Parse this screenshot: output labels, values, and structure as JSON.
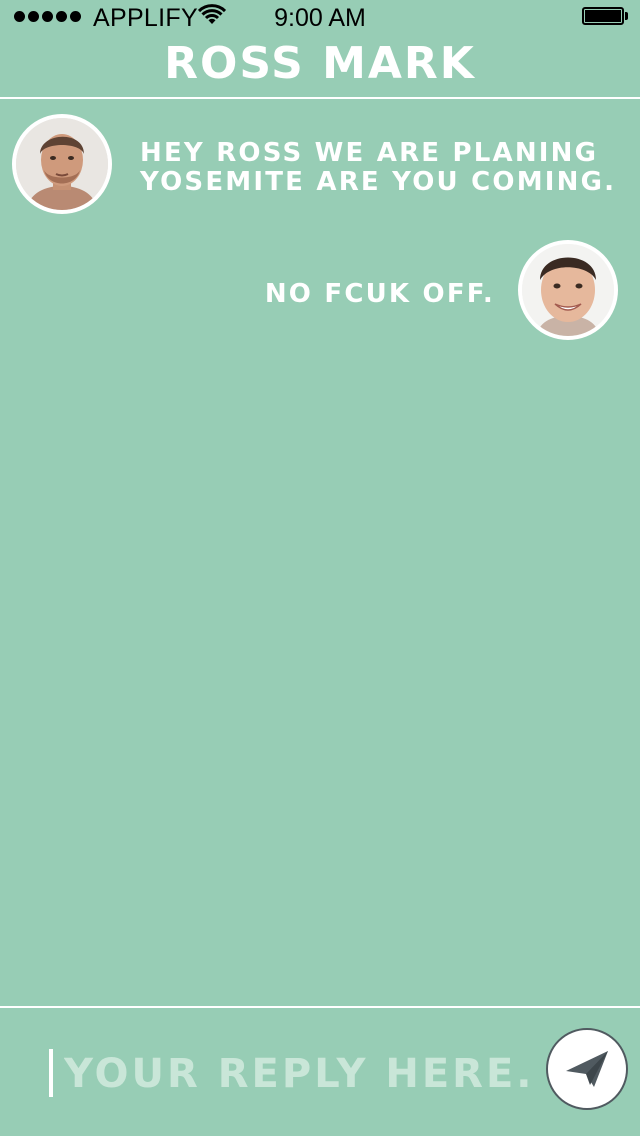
{
  "status_bar": {
    "carrier": "APPLIFY",
    "time": "9:00 AM",
    "signal_icon": "signal-dots-icon",
    "wifi_icon": "wifi-icon",
    "battery_icon": "battery-icon"
  },
  "header": {
    "title": "ROSS MARK"
  },
  "messages": [
    {
      "side": "left",
      "avatar": "contact-avatar",
      "lines": [
        "HEY ROSS WE ARE PLANING",
        "YOSEMITE ARE YOU COMING."
      ]
    },
    {
      "side": "right",
      "avatar": "user-avatar",
      "lines": [
        "NO FCUK OFF."
      ]
    }
  ],
  "composer": {
    "placeholder": "YOUR REPLY HERE..",
    "send_icon": "paper-plane-icon"
  },
  "colors": {
    "background": "#97cdb5",
    "text": "#ffffff",
    "placeholder": "#c9e6d8",
    "send_icon": "#505a60"
  }
}
